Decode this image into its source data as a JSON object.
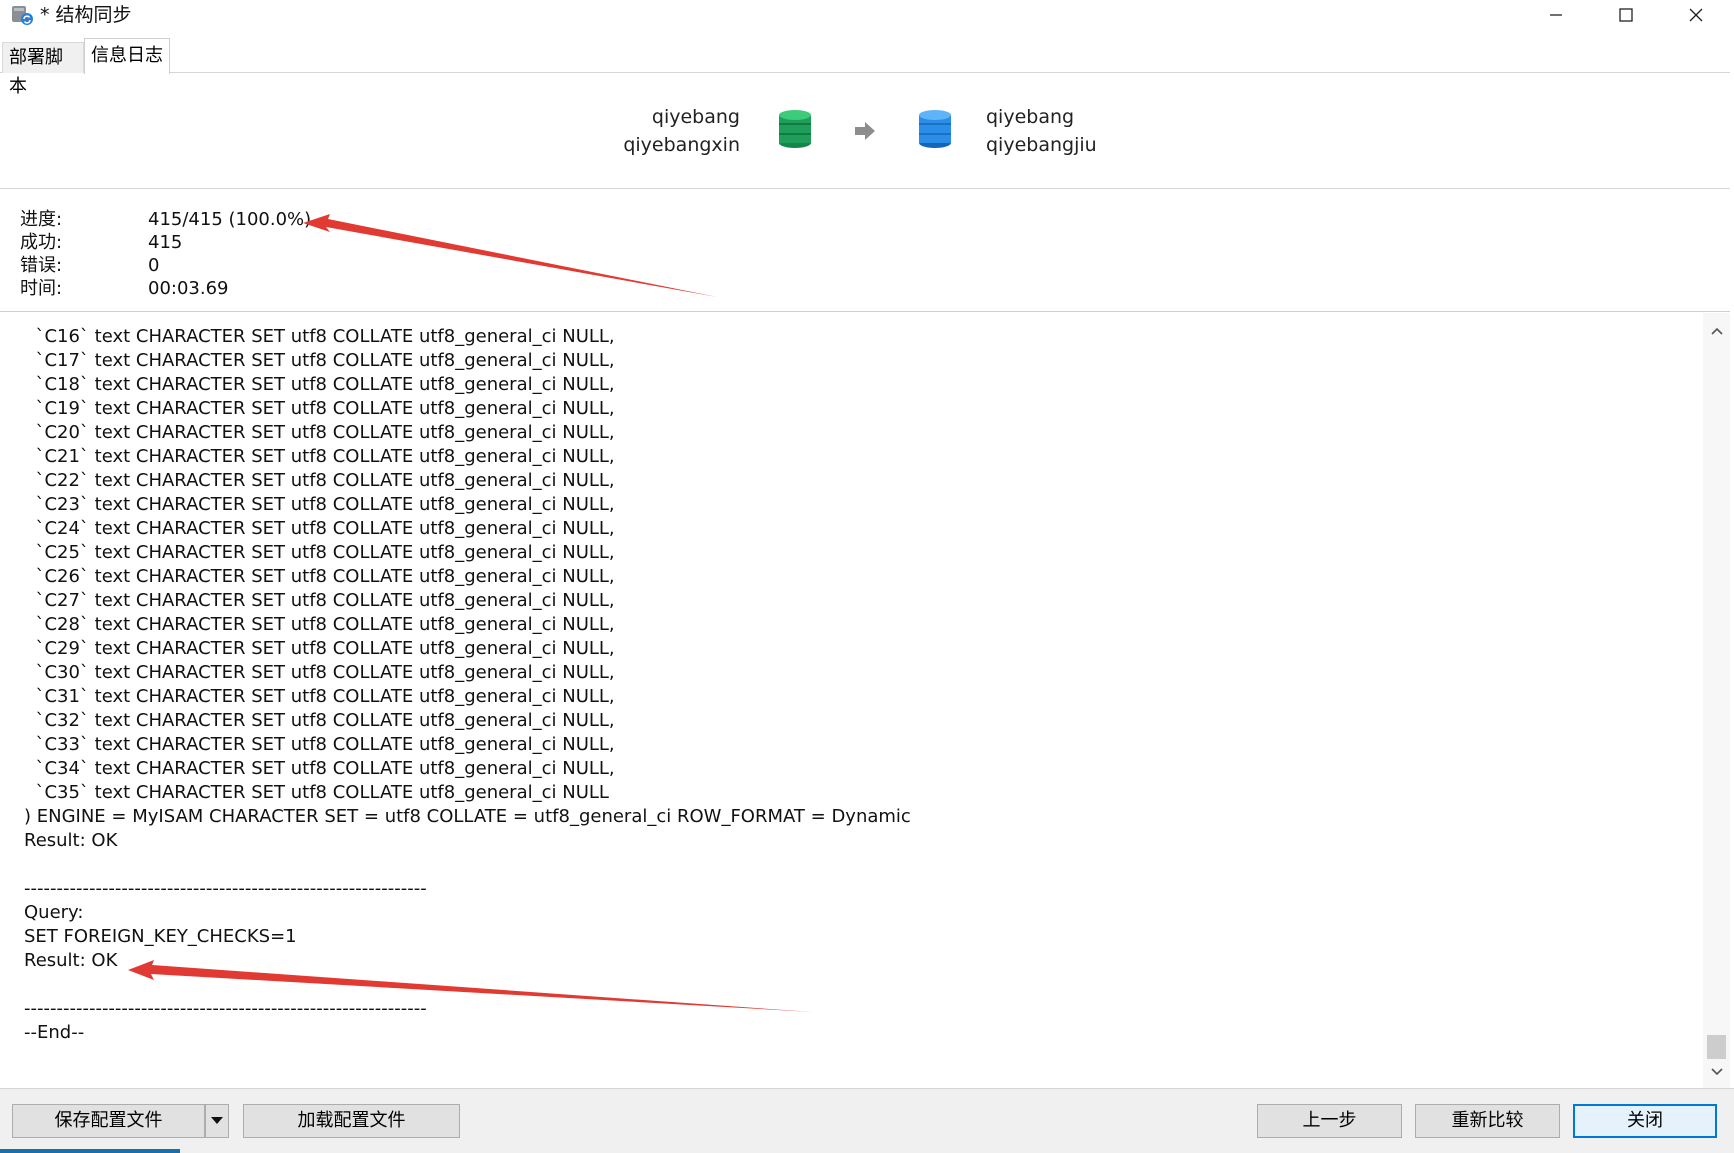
{
  "window": {
    "title": "* 结构同步",
    "controls": {
      "minimize": "minimize-icon",
      "maximize": "maximize-icon",
      "close": "close-icon"
    }
  },
  "tabs": [
    {
      "label": "部署脚本",
      "active": false
    },
    {
      "label": "信息日志",
      "active": true
    }
  ],
  "connection": {
    "source": {
      "connection": "qiyebang",
      "database": "qiyebangxin",
      "color": "#27ae60"
    },
    "target": {
      "connection": "qiyebang",
      "database": "qiyebangjiu",
      "color": "#2a8ee8"
    },
    "arrow_icon": "arrow-right-icon"
  },
  "stats": [
    {
      "label": "进度:",
      "value": "415/415 (100.0%)"
    },
    {
      "label": "成功:",
      "value": "415"
    },
    {
      "label": "错误:",
      "value": "0"
    },
    {
      "label": "时间:",
      "value": "00:03.69"
    }
  ],
  "log": {
    "lines": [
      "  `C16` text CHARACTER SET utf8 COLLATE utf8_general_ci NULL,",
      "  `C17` text CHARACTER SET utf8 COLLATE utf8_general_ci NULL,",
      "  `C18` text CHARACTER SET utf8 COLLATE utf8_general_ci NULL,",
      "  `C19` text CHARACTER SET utf8 COLLATE utf8_general_ci NULL,",
      "  `C20` text CHARACTER SET utf8 COLLATE utf8_general_ci NULL,",
      "  `C21` text CHARACTER SET utf8 COLLATE utf8_general_ci NULL,",
      "  `C22` text CHARACTER SET utf8 COLLATE utf8_general_ci NULL,",
      "  `C23` text CHARACTER SET utf8 COLLATE utf8_general_ci NULL,",
      "  `C24` text CHARACTER SET utf8 COLLATE utf8_general_ci NULL,",
      "  `C25` text CHARACTER SET utf8 COLLATE utf8_general_ci NULL,",
      "  `C26` text CHARACTER SET utf8 COLLATE utf8_general_ci NULL,",
      "  `C27` text CHARACTER SET utf8 COLLATE utf8_general_ci NULL,",
      "  `C28` text CHARACTER SET utf8 COLLATE utf8_general_ci NULL,",
      "  `C29` text CHARACTER SET utf8 COLLATE utf8_general_ci NULL,",
      "  `C30` text CHARACTER SET utf8 COLLATE utf8_general_ci NULL,",
      "  `C31` text CHARACTER SET utf8 COLLATE utf8_general_ci NULL,",
      "  `C32` text CHARACTER SET utf8 COLLATE utf8_general_ci NULL,",
      "  `C33` text CHARACTER SET utf8 COLLATE utf8_general_ci NULL,",
      "  `C34` text CHARACTER SET utf8 COLLATE utf8_general_ci NULL,",
      "  `C35` text CHARACTER SET utf8 COLLATE utf8_general_ci NULL",
      ") ENGINE = MyISAM CHARACTER SET = utf8 COLLATE = utf8_general_ci ROW_FORMAT = Dynamic",
      "Result: OK",
      "",
      "--------------------------------------------------------------",
      "Query:",
      "SET FOREIGN_KEY_CHECKS=1",
      "Result: OK",
      "",
      "--------------------------------------------------------------",
      "--End--"
    ]
  },
  "annotation_color": "#e03a32",
  "footer": {
    "save_config": "保存配置文件",
    "save_dropdown_icon": "dropdown-arrow-icon",
    "load_config": "加载配置文件",
    "prev_step": "上一步",
    "recompare": "重新比较",
    "close": "关闭"
  }
}
